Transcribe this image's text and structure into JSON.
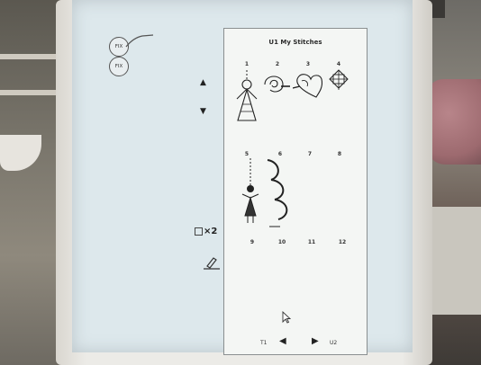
{
  "fix_buttons": {
    "top_label": "FIX",
    "bottom_label": "FIX"
  },
  "scroll": {
    "up_icon": "triangle-up-icon",
    "down_icon": "triangle-down-icon"
  },
  "tools": {
    "repeat_label": "×2",
    "repeat_icon": "stitch-repeat-icon",
    "edit_icon": "pencil-edit-icon"
  },
  "panel": {
    "title": "U1 My Stitches",
    "slots": [
      {
        "number": "1",
        "icon": "angel-stitch-icon"
      },
      {
        "number": "2",
        "icon": "swirl-stitch-icon"
      },
      {
        "number": "3",
        "icon": "heart-stitch-icon"
      },
      {
        "number": "4",
        "icon": "ornament-stitch-icon"
      },
      {
        "number": "5",
        "icon": "girl-figure-stitch-icon"
      },
      {
        "number": "6",
        "icon": "scallop-stitch-icon"
      },
      {
        "number": "7",
        "icon": ""
      },
      {
        "number": "8",
        "icon": ""
      },
      {
        "number": "9",
        "icon": ""
      },
      {
        "number": "10",
        "icon": ""
      },
      {
        "number": "11",
        "icon": ""
      },
      {
        "number": "12",
        "icon": ""
      }
    ]
  },
  "pagination": {
    "prev_label": "T1",
    "next_label": "U2"
  }
}
